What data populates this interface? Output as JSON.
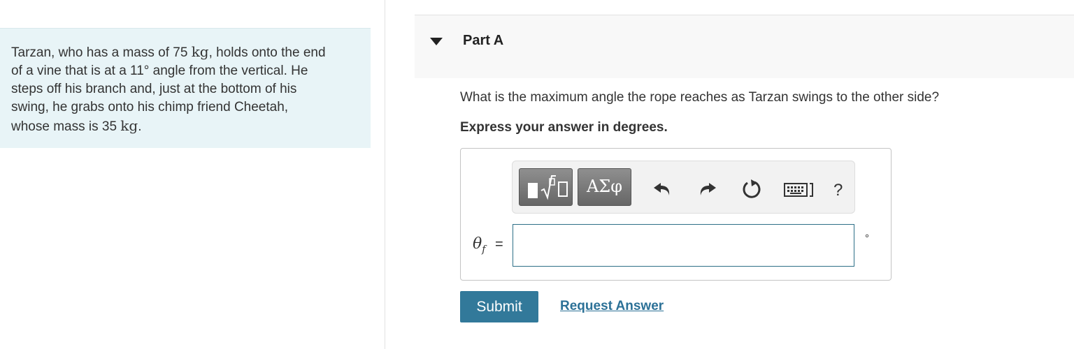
{
  "problem": {
    "line1_pre": "Tarzan, who has a mass of 75 ",
    "line1_unit": "kg",
    "line1_post": ", holds onto the end",
    "line2_pre": "of a vine that is at a 11",
    "line2_deg": "°",
    "line2_post": " angle from the vertical. He",
    "line3": "steps off his branch and, just at the bottom of his",
    "line4": "swing, he grabs onto his chimp friend Cheetah,",
    "line5_pre": "whose mass is 35 ",
    "line5_unit": "kg",
    "line5_post": "."
  },
  "part": {
    "title": "Part A"
  },
  "question": {
    "text": "What is the maximum angle the rope reaches as Tarzan swings to the other side?",
    "instruction": "Express your answer in degrees."
  },
  "toolbar": {
    "symbols_label": "ΑΣφ",
    "help_label": "?",
    "icons": {
      "templates": "templates-icon",
      "symbols": "greek-symbols-icon",
      "undo": "undo-icon",
      "redo": "redo-icon",
      "reset": "reset-icon",
      "keyboard": "keyboard-icon",
      "help": "help-icon"
    }
  },
  "answer": {
    "variable": "θ",
    "subscript": "f",
    "equals": "=",
    "value": "",
    "unit": "°"
  },
  "actions": {
    "submit_label": "Submit",
    "request_label": "Request Answer"
  },
  "colors": {
    "problem_bg": "#e8f4f7",
    "primary": "#32799a",
    "link": "#2c7197",
    "input_border": "#2d6f87"
  }
}
